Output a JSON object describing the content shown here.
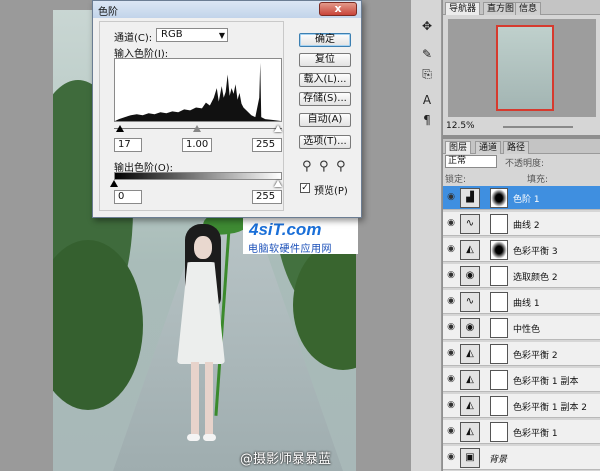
{
  "dialog": {
    "title": "色阶",
    "close": "x",
    "channel_label": "通道(C):",
    "channel_value": "RGB",
    "input_levels_label": "输入色阶(I):",
    "input_black": "17",
    "input_gamma": "1.00",
    "input_white": "255",
    "output_levels_label": "输出色阶(O):",
    "output_black": "0",
    "output_white": "255",
    "buttons": {
      "ok": "确定",
      "reset": "复位",
      "load": "载入(L)...",
      "save": "存储(S)...",
      "auto": "自动(A)",
      "options": "选项(T)..."
    },
    "preview_label": "预览(P)",
    "preview_checked": "✓"
  },
  "photo": {
    "watermark_logo": "4siT.com",
    "watermark_sub": "电脑软硬件应用网",
    "credit": "@摄影师暴暴蓝"
  },
  "navigator": {
    "tabs": [
      "导航器",
      "直方图",
      "信息"
    ],
    "zoom": "12.5%"
  },
  "layers_panel": {
    "tabs": [
      "图层",
      "通道",
      "路径"
    ],
    "blend_mode": "正常",
    "opacity_label": "不透明度:",
    "fill_label": "填充:",
    "lock_label": "锁定:",
    "layers": [
      {
        "name": "色阶 1",
        "icon": "levels-icon",
        "mask": "dark",
        "selected": true
      },
      {
        "name": "曲线 2",
        "icon": "curves-icon",
        "mask": "white",
        "selected": false
      },
      {
        "name": "色彩平衡 3",
        "icon": "balance-icon",
        "mask": "dark",
        "selected": false
      },
      {
        "name": "选取颜色 2",
        "icon": "selective-icon",
        "mask": "white",
        "selected": false
      },
      {
        "name": "曲线 1",
        "icon": "curves-icon",
        "mask": "white",
        "selected": false
      },
      {
        "name": "中性色",
        "icon": "selective-icon",
        "mask": "white",
        "selected": false
      },
      {
        "name": "色彩平衡 2",
        "icon": "balance-icon",
        "mask": "white",
        "selected": false
      },
      {
        "name": "色彩平衡 1 副本",
        "icon": "balance-icon",
        "mask": "white",
        "selected": false
      },
      {
        "name": "色彩平衡 1 副本 2",
        "icon": "balance-icon",
        "mask": "white",
        "selected": false
      },
      {
        "name": "色彩平衡 1",
        "icon": "balance-icon",
        "mask": "white",
        "selected": false
      },
      {
        "name": "背景",
        "icon": "image-icon",
        "mask": "none",
        "selected": false
      }
    ]
  },
  "colors": {
    "selection": "#3f8fe0",
    "close_button": "#c8443a",
    "nav_frame": "#d63a2e"
  }
}
